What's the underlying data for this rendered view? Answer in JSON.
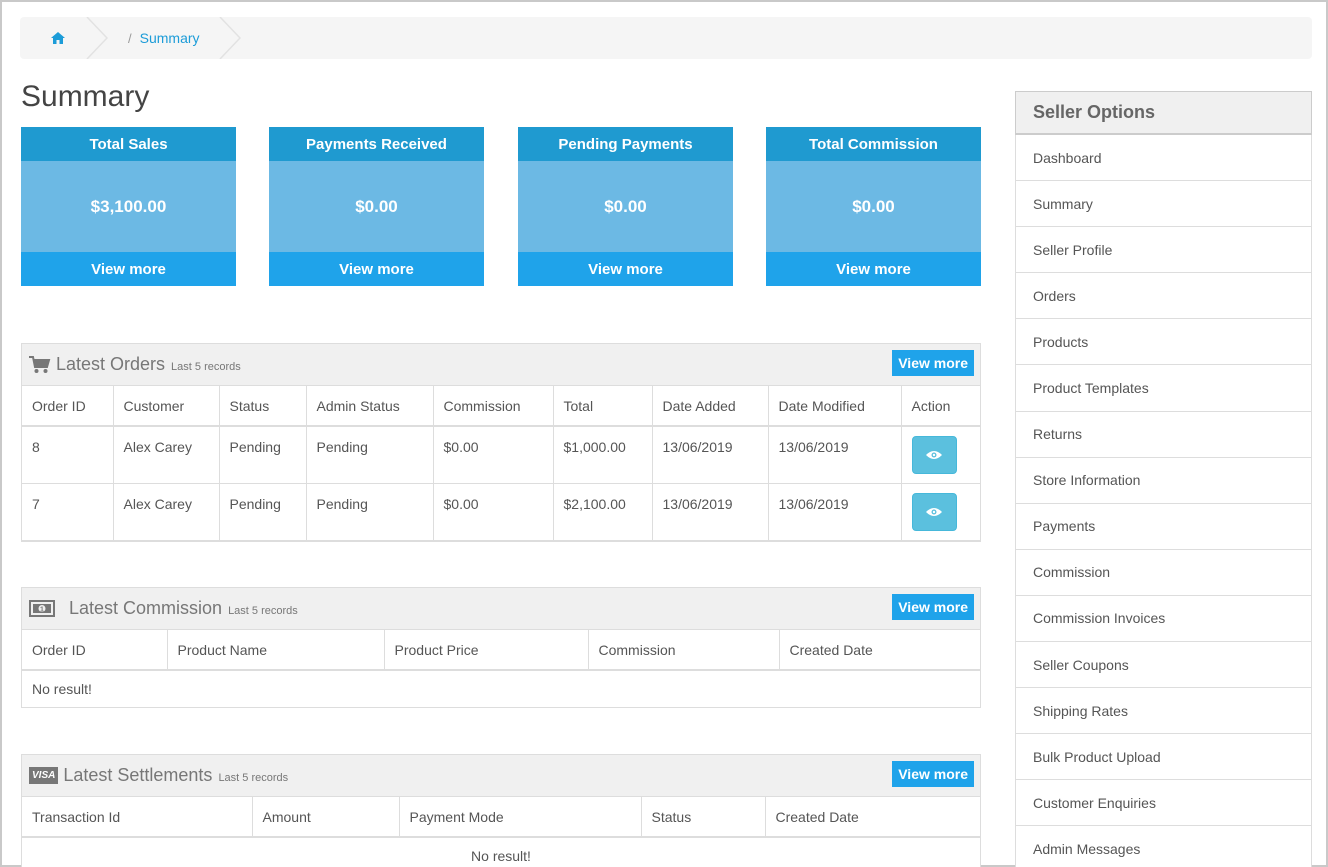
{
  "breadcrumb": {
    "home_icon": "home-icon",
    "separator": "/",
    "current": "Summary"
  },
  "page_title": "Summary",
  "stats": [
    {
      "title": "Total Sales",
      "value": "$3,100.00",
      "link": "View more"
    },
    {
      "title": "Payments Received",
      "value": "$0.00",
      "link": "View more"
    },
    {
      "title": "Pending Payments",
      "value": "$0.00",
      "link": "View more"
    },
    {
      "title": "Total Commission",
      "value": "$0.00",
      "link": "View more"
    }
  ],
  "orders": {
    "icon": "cart-icon",
    "title": "Latest Orders",
    "subtitle": "Last 5 records",
    "button": "View more",
    "columns": [
      "Order ID",
      "Customer",
      "Status",
      "Admin Status",
      "Commission",
      "Total",
      "Date Added",
      "Date Modified",
      "Action"
    ],
    "rows": [
      [
        "8",
        "Alex Carey",
        "Pending",
        "Pending",
        "$0.00",
        "$1,000.00",
        "13/06/2019",
        "13/06/2019"
      ],
      [
        "7",
        "Alex Carey",
        "Pending",
        "Pending",
        "$0.00",
        "$2,100.00",
        "13/06/2019",
        "13/06/2019"
      ]
    ]
  },
  "commission": {
    "icon": "money-icon",
    "title": "Latest Commission",
    "subtitle": "Last 5 records",
    "button": "View more",
    "columns": [
      "Order ID",
      "Product Name",
      "Product Price",
      "Commission",
      "Created Date"
    ],
    "empty": "No result!"
  },
  "settlements": {
    "icon": "visa-icon",
    "icon_text": "VISA",
    "title": "Latest Settlements",
    "subtitle": "Last 5 records",
    "button": "View more",
    "columns": [
      "Transaction Id",
      "Amount",
      "Payment Mode",
      "Status",
      "Created Date"
    ],
    "empty": "No result!"
  },
  "sidebar": {
    "title": "Seller Options",
    "items": [
      "Dashboard",
      "Summary",
      "Seller Profile",
      "Orders",
      "Products",
      "Product Templates",
      "Returns",
      "Store Information",
      "Payments",
      "Commission",
      "Commission Invoices",
      "Seller Coupons",
      "Shipping Rates",
      "Bulk Product Upload",
      "Customer Enquiries",
      "Admin Messages"
    ]
  },
  "colors": {
    "accent": "#1fa3ea",
    "stat_head": "#1f9ad0",
    "stat_body": "#6cb9e4",
    "link": "#1c9cd8",
    "eye_button": "#5bc0de"
  }
}
